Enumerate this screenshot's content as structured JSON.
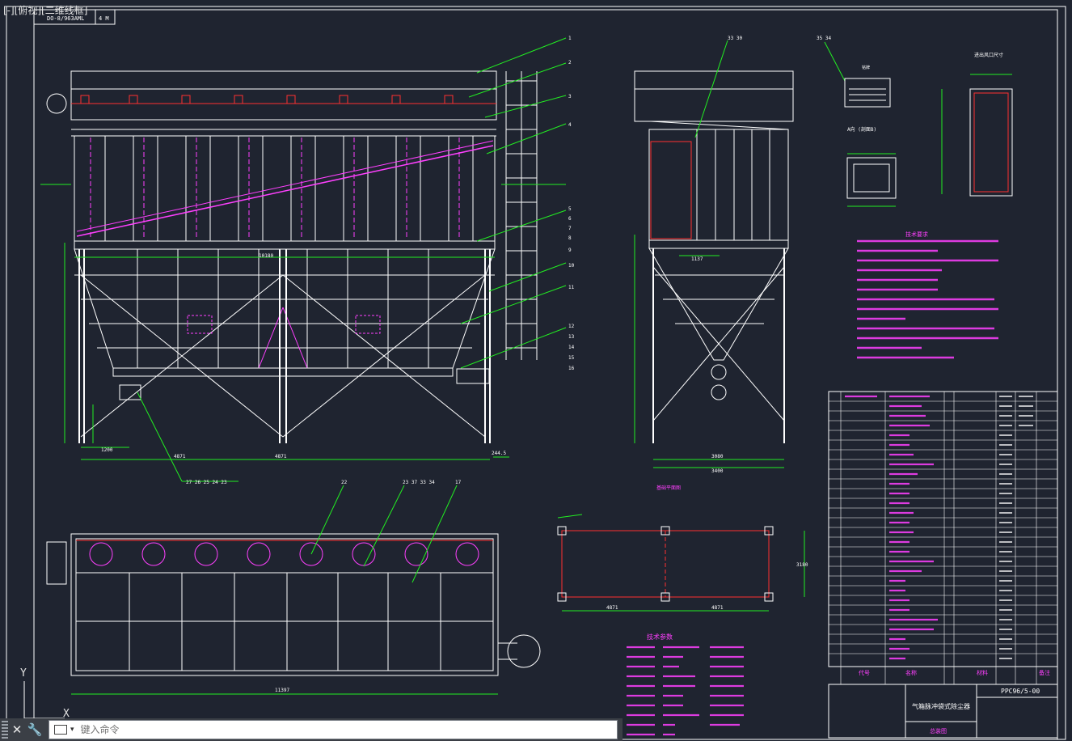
{
  "viewport": {
    "label": "[-][俯视][二维线框]"
  },
  "drawing": {
    "title_box": [
      "DO-8/963AML",
      "4 M"
    ],
    "title_block": {
      "name": "气箱脉冲袋式除尘器",
      "drawing_no": "PPC96/5-00",
      "sheet": "总装图"
    },
    "annotations": {
      "tech_req_title": "技术要求",
      "tech_params_title": "技术参数",
      "table_header_code": "代号",
      "table_header_name": "名称",
      "table_header_material": "材料",
      "table_header_note": "备注",
      "section_a": "A向 (剖面B)",
      "embedded_title": "基础平面图",
      "dim_total": "11397"
    }
  },
  "command_line": {
    "placeholder": "键入命令",
    "close_label": "✕",
    "settings_label": "🔧"
  },
  "ucs": {
    "x_label": "X",
    "y_label": "Y"
  },
  "colors": {
    "background": "#1f2430",
    "frame": "#ffffff",
    "red": "#ff3030",
    "magenta": "#ff40ff",
    "green": "#22ee22",
    "white": "#ffffff"
  }
}
